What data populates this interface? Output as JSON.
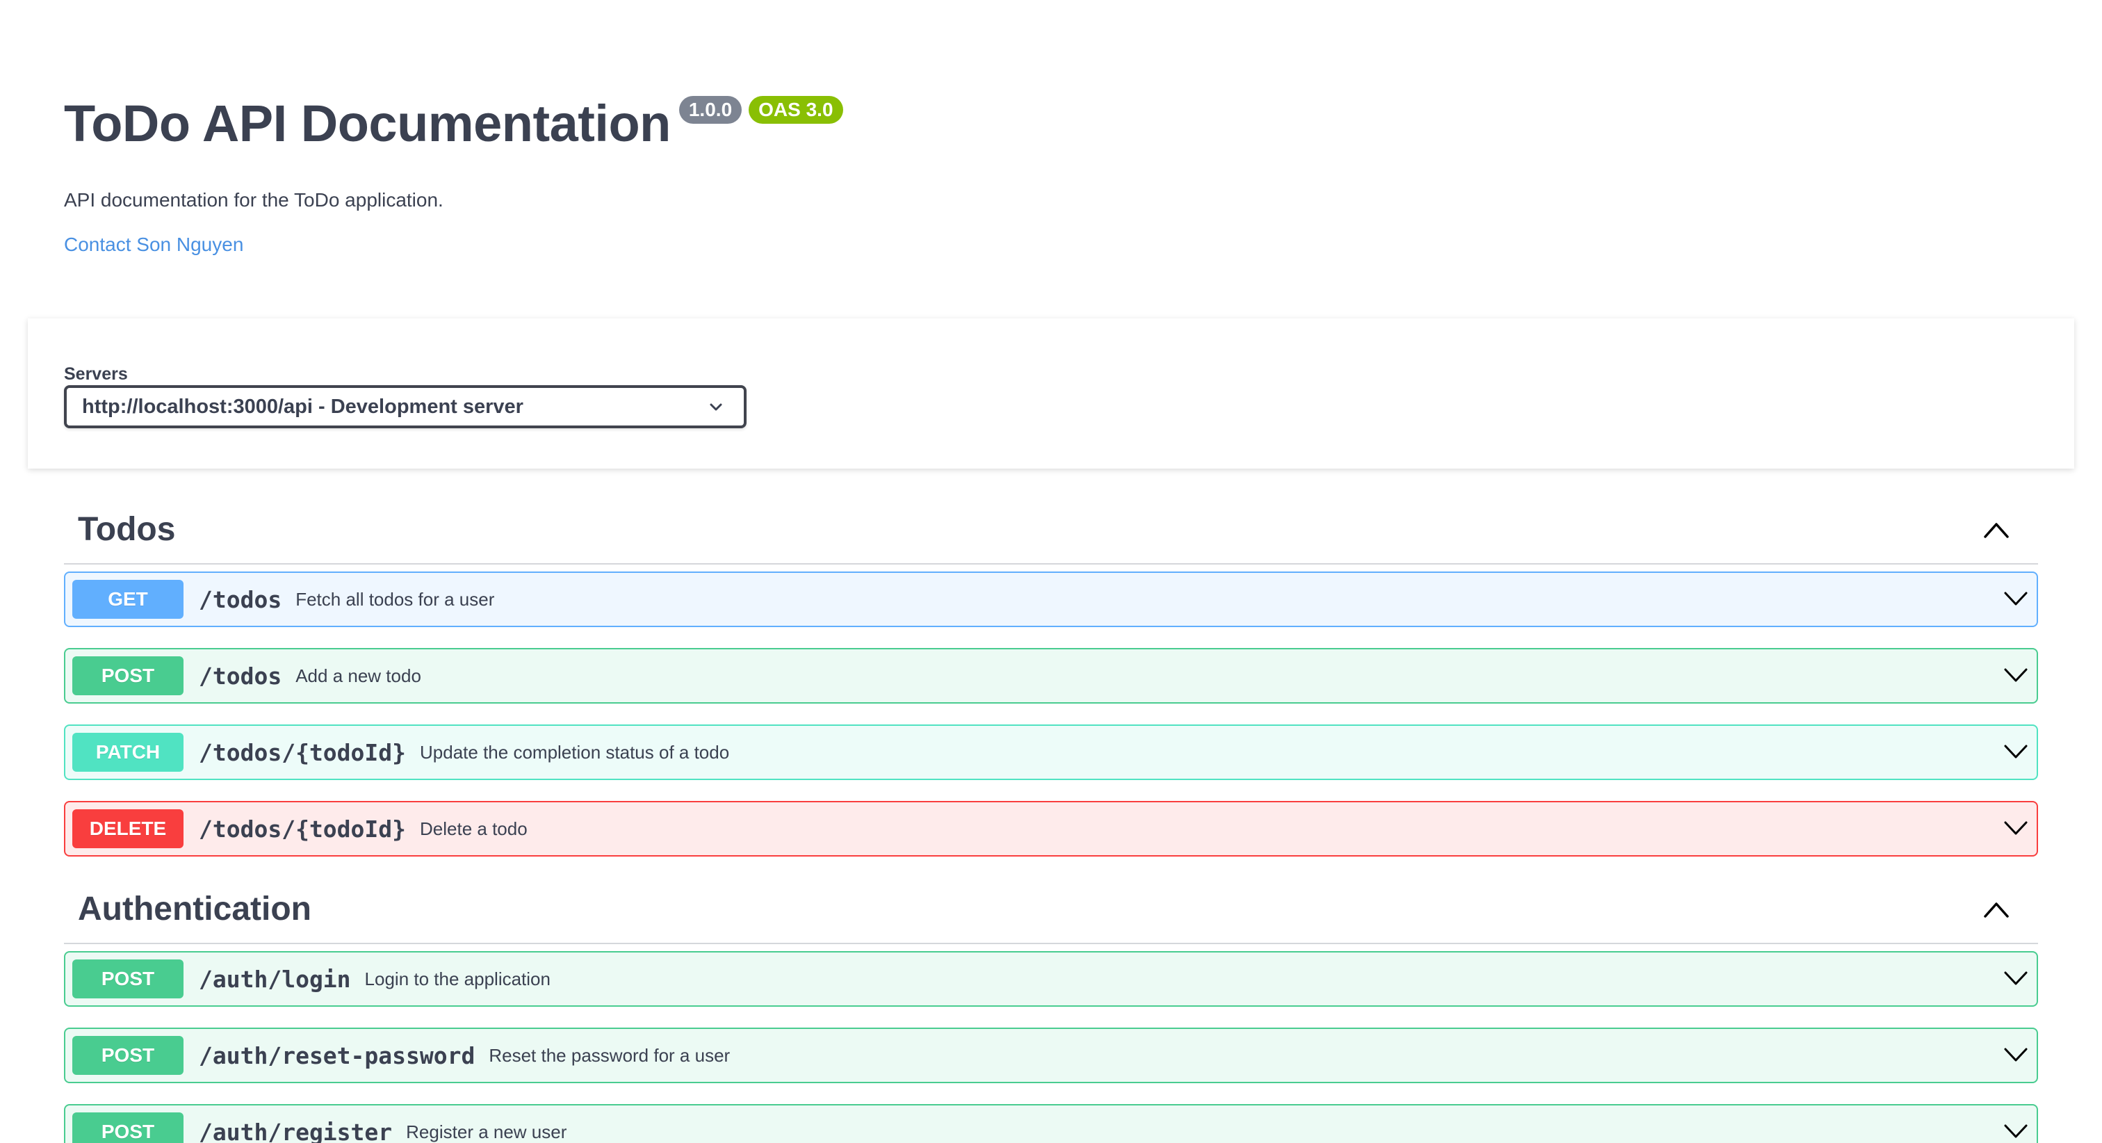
{
  "info": {
    "title": "ToDo API Documentation",
    "version_badge": "1.0.0",
    "oas_badge": "OAS 3.0",
    "description": "API documentation for the ToDo application.",
    "contact_link": "Contact Son Nguyen"
  },
  "servers": {
    "label": "Servers",
    "selected": "http://localhost:3000/api - Development server"
  },
  "tags": [
    {
      "name": "Todos",
      "operations": [
        {
          "method": "GET",
          "path": "/todos",
          "summary": "Fetch all todos for a user"
        },
        {
          "method": "POST",
          "path": "/todos",
          "summary": "Add a new todo"
        },
        {
          "method": "PATCH",
          "path": "/todos/{todoId}",
          "summary": "Update the completion status of a todo"
        },
        {
          "method": "DELETE",
          "path": "/todos/{todoId}",
          "summary": "Delete a todo"
        }
      ]
    },
    {
      "name": "Authentication",
      "operations": [
        {
          "method": "POST",
          "path": "/auth/login",
          "summary": "Login to the application"
        },
        {
          "method": "POST",
          "path": "/auth/reset-password",
          "summary": "Reset the password for a user"
        },
        {
          "method": "POST",
          "path": "/auth/register",
          "summary": "Register a new user"
        }
      ]
    }
  ],
  "colors": {
    "get": "#61affe",
    "post": "#49cc90",
    "patch": "#50e3c2",
    "delete": "#f93e3e",
    "link": "#4990e2",
    "text": "#3b4151"
  },
  "icons": {
    "tag_toggle": "chevron-up-icon",
    "operation_toggle": "chevron-down-icon",
    "select_toggle": "chevron-down-icon"
  }
}
